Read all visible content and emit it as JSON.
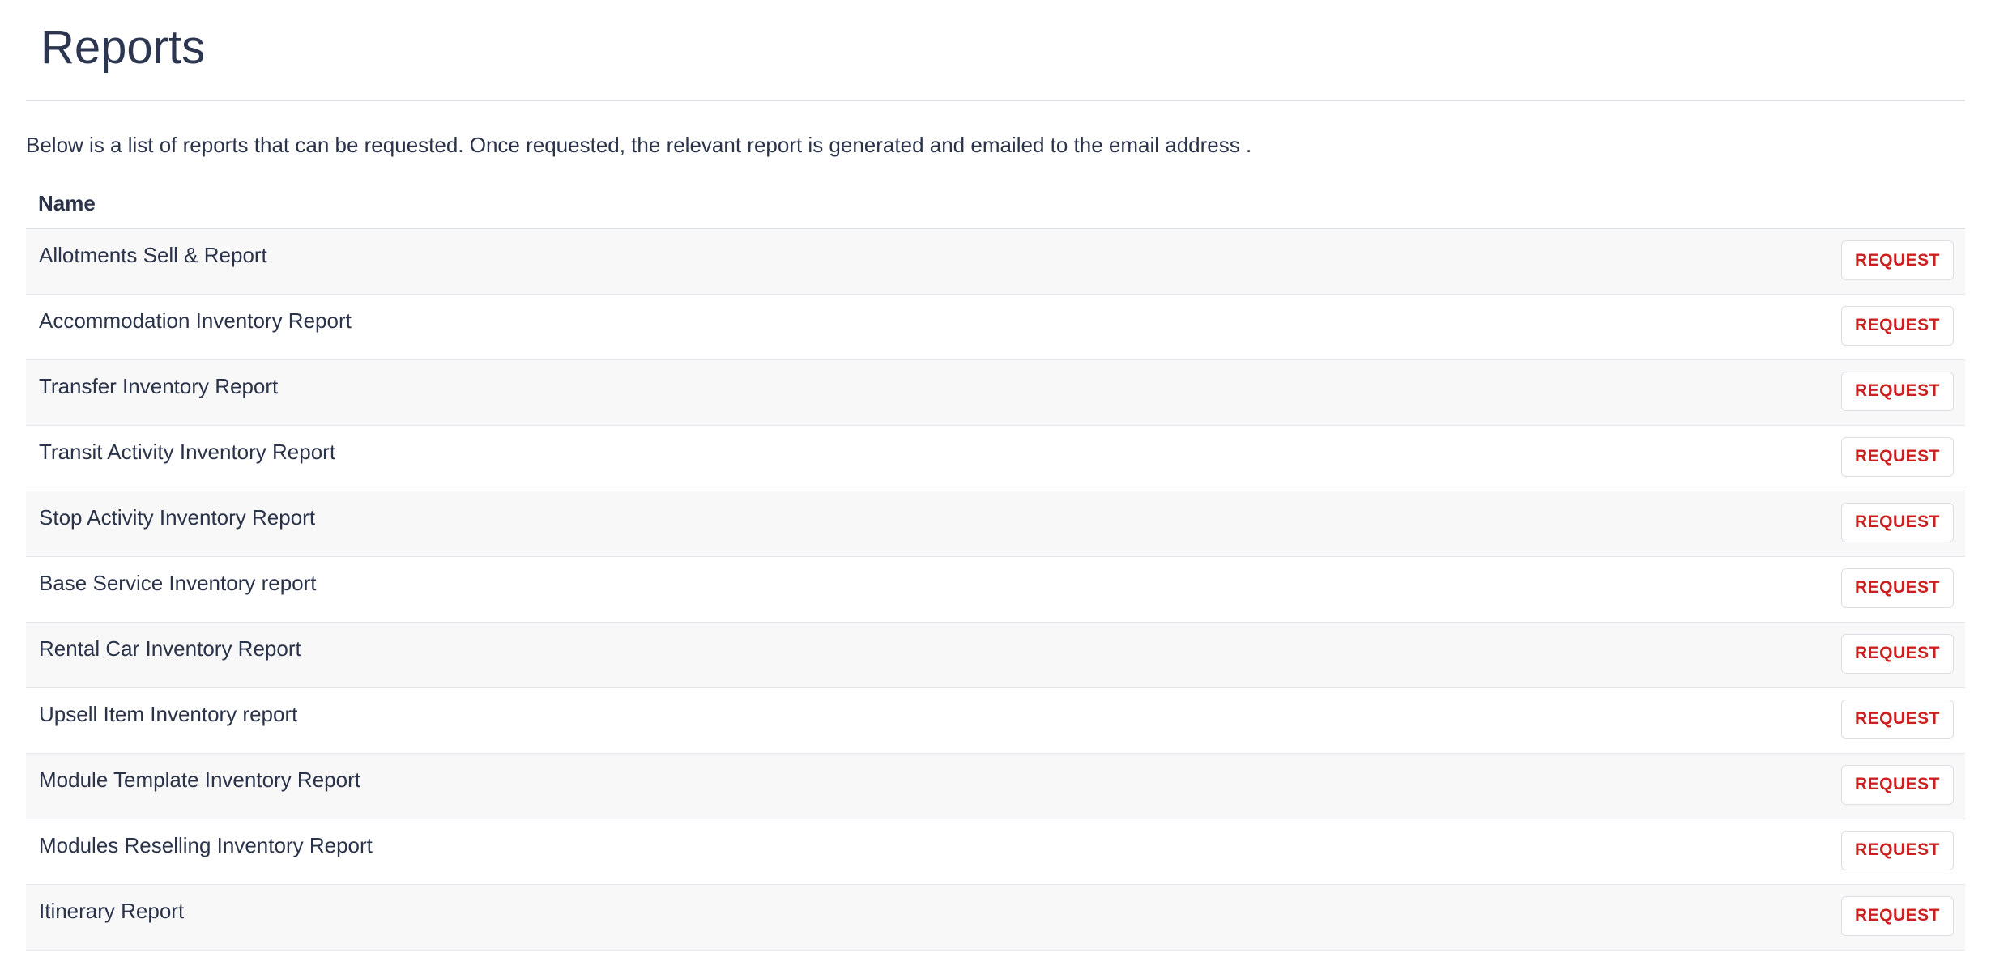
{
  "page": {
    "title": "Reports",
    "description": "Below is a list of reports that can be requested. Once requested, the relevant report is generated and emailed to the email address ."
  },
  "table": {
    "headers": {
      "name": "Name",
      "action": ""
    },
    "request_label": "REQUEST",
    "rows": [
      {
        "name": "Allotments Sell & Report"
      },
      {
        "name": "Accommodation Inventory Report"
      },
      {
        "name": "Transfer Inventory Report"
      },
      {
        "name": "Transit Activity Inventory Report"
      },
      {
        "name": "Stop Activity Inventory Report"
      },
      {
        "name": "Base Service Inventory report"
      },
      {
        "name": "Rental Car Inventory Report"
      },
      {
        "name": "Upsell Item Inventory report"
      },
      {
        "name": "Module Template Inventory Report"
      },
      {
        "name": "Modules Reselling Inventory Report"
      },
      {
        "name": "Itinerary Report"
      }
    ]
  },
  "colors": {
    "text": "#2a3349",
    "accent": "#cc1f1f",
    "row_stripe": "#f8f8f8",
    "divider": "#dcdee3"
  }
}
